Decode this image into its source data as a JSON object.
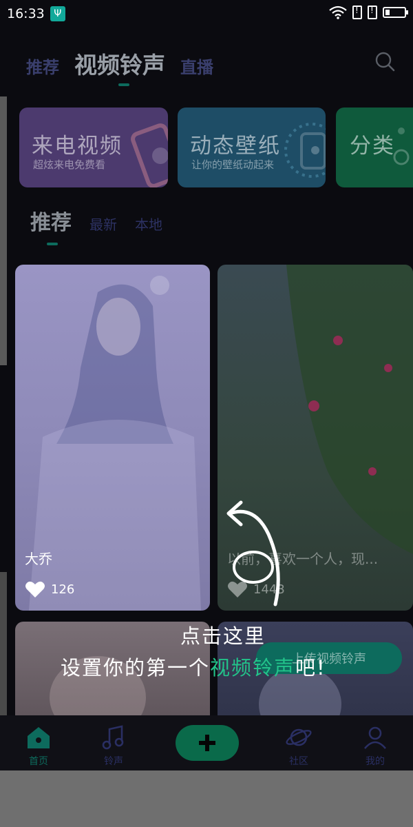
{
  "status_bar": {
    "time": "16:33"
  },
  "header": {
    "tabs": [
      {
        "label": "推荐"
      },
      {
        "label": "视频铃声"
      },
      {
        "label": "直播"
      }
    ]
  },
  "feature_cards": [
    {
      "title": "来电视频",
      "subtitle": "超炫来电免费看"
    },
    {
      "title": "动态壁纸",
      "subtitle": "让你的壁纸动起来"
    },
    {
      "title": "分类",
      "subtitle": ""
    }
  ],
  "sub_tabs": [
    {
      "label": "推荐"
    },
    {
      "label": "最新"
    },
    {
      "label": "本地"
    }
  ],
  "videos": [
    {
      "title": "大乔",
      "likes": "126"
    },
    {
      "title": "以前，喜欢一个人，现...",
      "likes": "1443"
    }
  ],
  "upload_button": {
    "label": "上传视频铃声"
  },
  "coach": {
    "line1": "点击这里",
    "line2_prefix": "设置你的第一个",
    "line2_highlight": "视频铃声",
    "line2_suffix": "吧!"
  },
  "bottom_nav": [
    {
      "label": "首页"
    },
    {
      "label": "铃声"
    },
    {
      "label": "社区"
    },
    {
      "label": "我的"
    }
  ],
  "colors": {
    "accent": "#0d6b5d",
    "highlight": "#22c38a"
  }
}
